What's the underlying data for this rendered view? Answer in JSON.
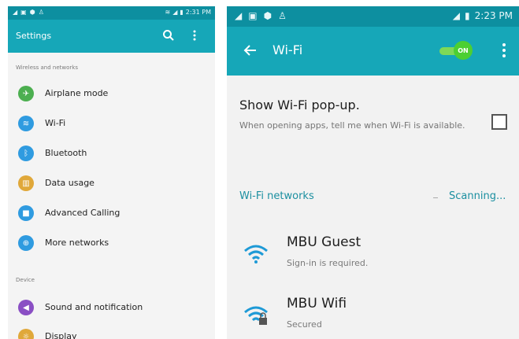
{
  "colors": {
    "status_bar": "#0d8fa0",
    "app_bar": "#16a7b8",
    "accent": "#1b8fa0",
    "toggle_on": "#4ccf32"
  },
  "left_screen": {
    "status_bar": {
      "time": "2:31 PM",
      "icons": [
        "notification-icon",
        "gallery-icon",
        "shield-icon",
        "figure-icon",
        "wifi-signal-icon",
        "cell-signal-icon",
        "battery-icon"
      ]
    },
    "app_bar": {
      "title": "Settings",
      "icons": [
        "search-icon",
        "more-vertical-icon"
      ]
    },
    "section_wireless": "Wireless and networks",
    "wireless_items": [
      {
        "label": "Airplane mode",
        "icon": "airplane-icon",
        "color": "#4caf50"
      },
      {
        "label": "Wi-Fi",
        "icon": "wifi-icon",
        "color": "#2f9be0"
      },
      {
        "label": "Bluetooth",
        "icon": "bluetooth-icon",
        "color": "#2f9be0"
      },
      {
        "label": "Data usage",
        "icon": "data-usage-icon",
        "color": "#e0a83a"
      },
      {
        "label": "Advanced Calling",
        "icon": "video-call-icon",
        "color": "#2f9be0"
      },
      {
        "label": "More networks",
        "icon": "more-networks-icon",
        "color": "#2f9be0"
      }
    ],
    "section_device": "Device",
    "device_items": [
      {
        "label": "Sound and notification",
        "icon": "sound-icon",
        "color": "#8a4fc4"
      },
      {
        "label": "Display",
        "icon": "display-icon",
        "color": "#e0a83a"
      }
    ]
  },
  "right_screen": {
    "status_bar": {
      "time": "2:23 PM",
      "icons": [
        "notification-icon",
        "gallery-icon",
        "shield-icon",
        "figure-icon",
        "cell-signal-icon",
        "battery-icon"
      ]
    },
    "app_bar": {
      "title": "Wi-Fi",
      "toggle_label": "ON",
      "toggle_on": true,
      "icons": [
        "back-arrow-icon",
        "more-vertical-icon"
      ]
    },
    "popup_setting": {
      "title": "Show Wi-Fi pop-up.",
      "description": "When opening apps, tell me when Wi-Fi is available.",
      "checked": false
    },
    "networks_section": {
      "label": "Wi-Fi networks",
      "status": "Scanning..."
    },
    "networks": [
      {
        "name": "MBU Guest",
        "status": "Sign-in is required.",
        "icon": "wifi-open-icon"
      },
      {
        "name": "MBU Wifi",
        "status": "Secured",
        "icon": "wifi-secured-icon"
      }
    ]
  }
}
